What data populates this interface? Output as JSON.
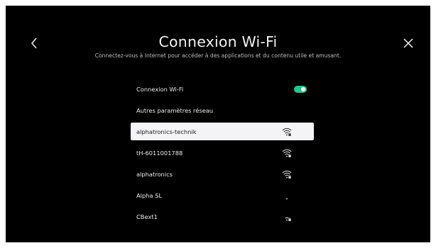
{
  "header": {
    "title": "Connexion Wi-Fi",
    "subtitle": "Connectez-vous à Internet pour accéder à des applications et du contenu utile et amusant."
  },
  "settings": {
    "wifi_toggle_label": "Connexion Wi-Fi",
    "wifi_enabled": true,
    "other_settings_label": "Autres paramètres réseau"
  },
  "networks": [
    {
      "ssid": "alphatronics-technik",
      "signal": "strong",
      "locked": true,
      "selected": true
    },
    {
      "ssid": "tH-6011001788",
      "signal": "strong",
      "locked": true,
      "selected": false
    },
    {
      "ssid": "alphatronics",
      "signal": "strong",
      "locked": true,
      "selected": false
    },
    {
      "ssid": "Alpha SL",
      "signal": "weak",
      "locked": false,
      "selected": false
    },
    {
      "ssid": "CBext1",
      "signal": "medium",
      "locked": true,
      "selected": false
    }
  ],
  "icons": {
    "back": "chevron-left-icon",
    "close": "close-icon",
    "wifi": "wifi-icon",
    "lock": "lock-icon"
  },
  "colors": {
    "background": "#000000",
    "toggle_on": "#1ec98a",
    "selected_row": "#f4f4f6"
  }
}
